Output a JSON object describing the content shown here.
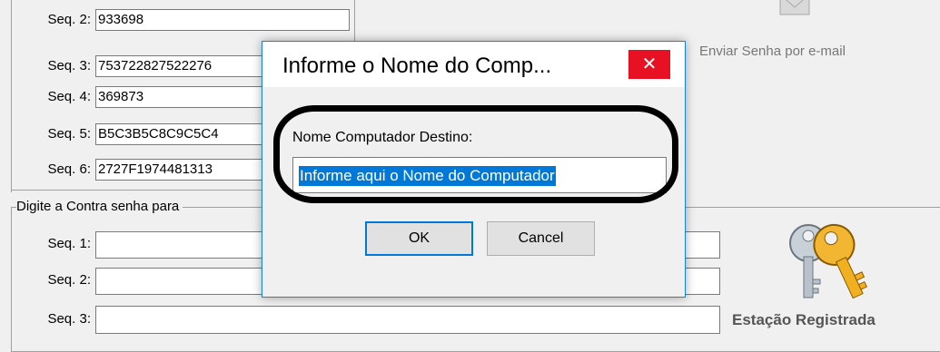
{
  "top_group": {
    "rows": [
      {
        "label": "Seq. 2:",
        "value": "933698"
      },
      {
        "label": "Seq. 3:",
        "value": "753722827522276"
      },
      {
        "label": "Seq. 4:",
        "value": "369873"
      },
      {
        "label": "Seq. 5:",
        "value": "B5C3B5C8C9C5C4"
      },
      {
        "label": "Seq. 6:",
        "value": "2727F1974481313"
      }
    ]
  },
  "email_link": {
    "label": "Enviar Senha por e-mail",
    "icon": "envelope-icon"
  },
  "bottom_group": {
    "title": "Digite a Contra senha para",
    "rows": [
      {
        "label": "Seq. 1:",
        "value": ""
      },
      {
        "label": "Seq. 2:",
        "value": ""
      },
      {
        "label": "Seq. 3:",
        "value": ""
      }
    ]
  },
  "registration": {
    "label": "Estação Registrada",
    "icon": "keys-icon"
  },
  "dialog": {
    "title": "Informe o Nome do Comp...",
    "close_symbol": "✕",
    "field_label": "Nome Computador Destino:",
    "field_value": "Informe aqui o Nome do Computador",
    "ok_label": "OK",
    "cancel_label": "Cancel"
  }
}
